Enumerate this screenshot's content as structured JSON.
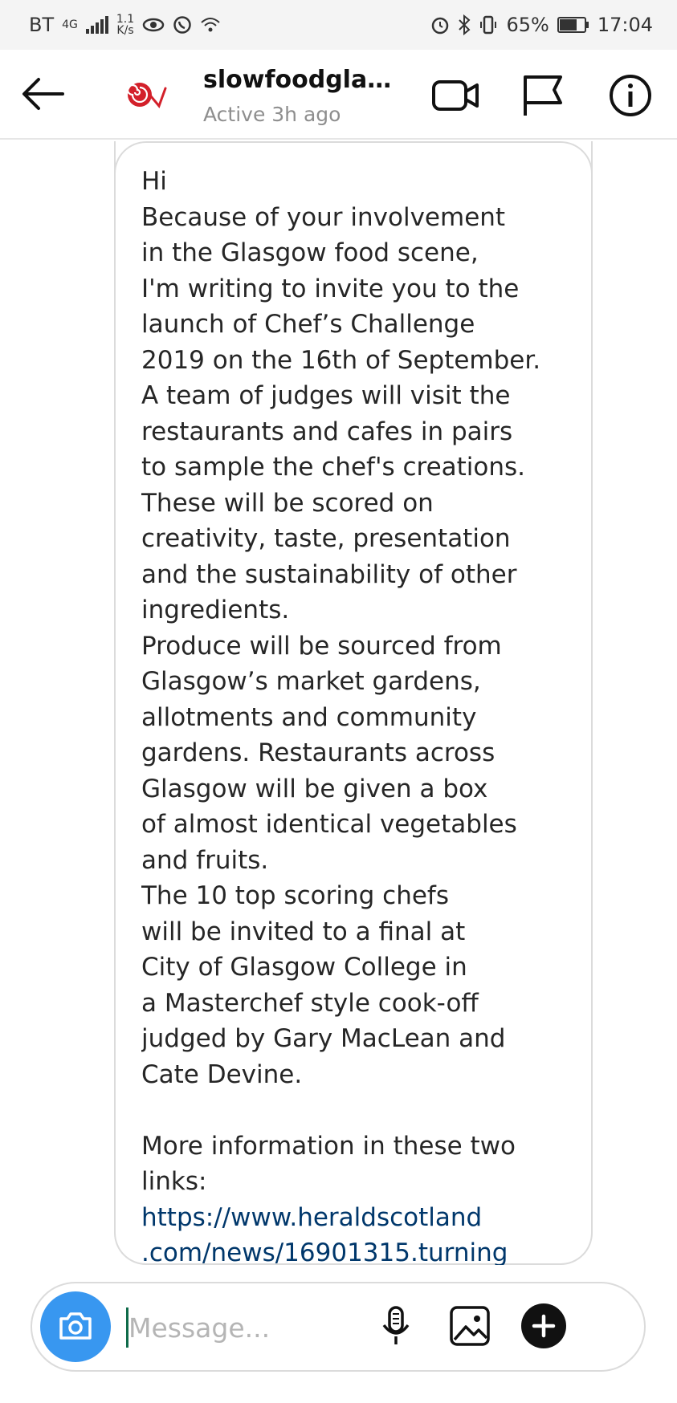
{
  "status_bar": {
    "carrier": "BT",
    "network": "4G",
    "speed_value": "1.1",
    "speed_unit": "K/s",
    "battery": "65%",
    "time": "17:04"
  },
  "header": {
    "username": "slowfoodglasg...",
    "activity": "Active 3h ago",
    "icons": [
      "back-arrow-icon",
      "video-call-icon",
      "flag-icon",
      "info-icon"
    ]
  },
  "message": {
    "lines": [
      "Hi",
      "Because of your involvement",
      "in the Glasgow food scene,",
      "I'm writing to invite you to the",
      "launch of Chef’s Challenge",
      "2019 on the 16th of September.",
      "A team of judges will visit the",
      "restaurants and cafes in pairs",
      "to sample the chef's creations.",
      "These will be scored on",
      "creativity, taste, presentation",
      "and the sustainability of other",
      "ingredients.",
      "Produce will be sourced from",
      "Glasgow’s market gardens,",
      "allotments and community",
      "gardens. Restaurants across",
      "Glasgow will be given a box",
      "of almost identical vegetables",
      "and fruits.",
      "The 10 top scoring chefs",
      "will be invited to a final at",
      "City of Glasgow College in",
      "a Masterchef style cook-off",
      "judged by Gary MacLean and",
      "Cate Devine."
    ],
    "more_info_lines": [
      "More information in these two",
      "links:"
    ],
    "link_lines": [
      "https://www.heraldscotland",
      ".com/news/16901315.turning"
    ]
  },
  "composer": {
    "placeholder": "Message...",
    "icons": [
      "camera-icon",
      "microphone-icon",
      "gallery-icon",
      "plus-icon"
    ]
  },
  "colors": {
    "camera_button": "#3897f0",
    "link": "#00376b",
    "border": "#dbdbdb",
    "muted_text": "#8e8e8e"
  }
}
